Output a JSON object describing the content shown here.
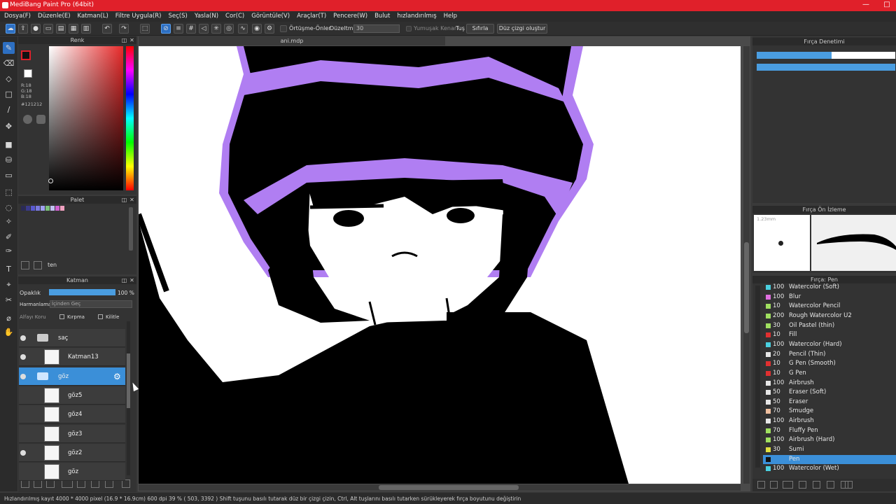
{
  "app": {
    "title": "MediBang Paint Pro (64bit)"
  },
  "menu": [
    "Dosya(F)",
    "Düzenle(E)",
    "Katman(L)",
    "Filtre Uygula(R)",
    "Seç(S)",
    "Yasla(N)",
    "Cor(C)",
    "Görüntüle(V)",
    "Araçlar(T)",
    "Pencere(W)",
    "Bulut",
    "hızlandırılmış",
    "Help"
  ],
  "toolbar": {
    "overlap_label": "Örtüşme-Önler",
    "correction_label": "Düzeltme",
    "correction_value": "30",
    "soft_edge_label": "Yumuşak Kenar",
    "tus_label": "Tuş",
    "reset_label": "Sıfırla",
    "line_label": "Düz çizgi oluştur"
  },
  "color_panel": {
    "title": "Renk",
    "r": "R:18",
    "g": "G:18",
    "b": "B:18",
    "hex": "#121212",
    "primary": "#121212",
    "accent": "#e0202a"
  },
  "palette_panel": {
    "title": "Palet",
    "name": "ten",
    "swatches": [
      "#2a2a55",
      "#3a3a8a",
      "#5a5ad0",
      "#7a7ae0",
      "#a0a0f0",
      "#7ac07a",
      "#c0c0f0",
      "#d060d0",
      "#f0a0c0"
    ]
  },
  "layer_panel": {
    "title": "Katman",
    "opacity_label": "Opaklık",
    "opacity_value": "100 %",
    "opacity_fraction": 1.0,
    "blend_label": "Harmanlama",
    "blend_value": "İçinden Geç",
    "alpha_lock": "Alfayı Koru",
    "clipping": "Kırpma",
    "lock": "Kilitle",
    "layers": [
      {
        "name": "saç",
        "type": "folder",
        "visible": true,
        "selected": false
      },
      {
        "name": "Katman13",
        "type": "layer",
        "visible": true,
        "selected": false
      },
      {
        "name": "göz",
        "type": "folder",
        "visible": true,
        "selected": true
      },
      {
        "name": "göz5",
        "type": "layer",
        "visible": false,
        "selected": false
      },
      {
        "name": "göz4",
        "type": "layer",
        "visible": false,
        "selected": false
      },
      {
        "name": "göz3",
        "type": "layer",
        "visible": false,
        "selected": false
      },
      {
        "name": "göz2",
        "type": "layer",
        "visible": true,
        "selected": false
      },
      {
        "name": "göz",
        "type": "layer",
        "visible": false,
        "selected": false
      }
    ]
  },
  "document": {
    "tab": "ani.mdp"
  },
  "brush_control": {
    "title": "Fırça Denetimi"
  },
  "brush_preview": {
    "title": "Fırça Ön İzleme",
    "size": "1.23mm"
  },
  "brush_list": {
    "title": "Fırça: Pen",
    "items": [
      {
        "value": "100",
        "name": "Watercolor (Soft)",
        "color": "#4ad0e0"
      },
      {
        "value": "100",
        "name": "Blur",
        "color": "#e070e0"
      },
      {
        "value": "10",
        "name": "Watercolor Pencil",
        "color": "#a0e060"
      },
      {
        "value": "200",
        "name": "Rough Watercolor U2",
        "color": "#a0e060"
      },
      {
        "value": "30",
        "name": "Oil Pastel (thin)",
        "color": "#a0e060"
      },
      {
        "value": "10",
        "name": "Fill",
        "color": "#e03030"
      },
      {
        "value": "100",
        "name": "Watercolor (Hard)",
        "color": "#4ad0e0"
      },
      {
        "value": "20",
        "name": "Pencil (Thin)",
        "color": "#e8e8e8"
      },
      {
        "value": "10",
        "name": "G Pen (Smooth)",
        "color": "#e03030"
      },
      {
        "value": "10",
        "name": "G Pen",
        "color": "#e03030"
      },
      {
        "value": "100",
        "name": "Airbrush",
        "color": "#e8e8e8"
      },
      {
        "value": "50",
        "name": "Eraser (Soft)",
        "color": "#e8e8e8"
      },
      {
        "value": "50",
        "name": "Eraser",
        "color": "#e8e8e8"
      },
      {
        "value": "70",
        "name": "Smudge",
        "color": "#f0c0a0"
      },
      {
        "value": "100",
        "name": "Airbrush",
        "color": "#e8e8e8"
      },
      {
        "value": "70",
        "name": "Fluffy Pen",
        "color": "#a0e060"
      },
      {
        "value": "100",
        "name": "Airbrush (Hard)",
        "color": "#a0e060"
      },
      {
        "value": "30",
        "name": "Sumi",
        "color": "#e0e040"
      },
      {
        "value": "",
        "name": "Pen",
        "color": "#121212"
      },
      {
        "value": "100",
        "name": "Watercolor (Wet)",
        "color": "#4ad0e0"
      }
    ],
    "selected_index": 18
  },
  "status": {
    "text": "Hızlandırılmış kayıt  4000 * 4000 pixel  (16.9 * 16.9cm)  600 dpi  39 %  ( 503, 3392 )  Shift tuşunu basılı tutarak düz bir çizgi çizin, Ctrl, Alt tuşlarını basılı tutarken sürükleyerek fırça boyutunu değiştirin"
  }
}
